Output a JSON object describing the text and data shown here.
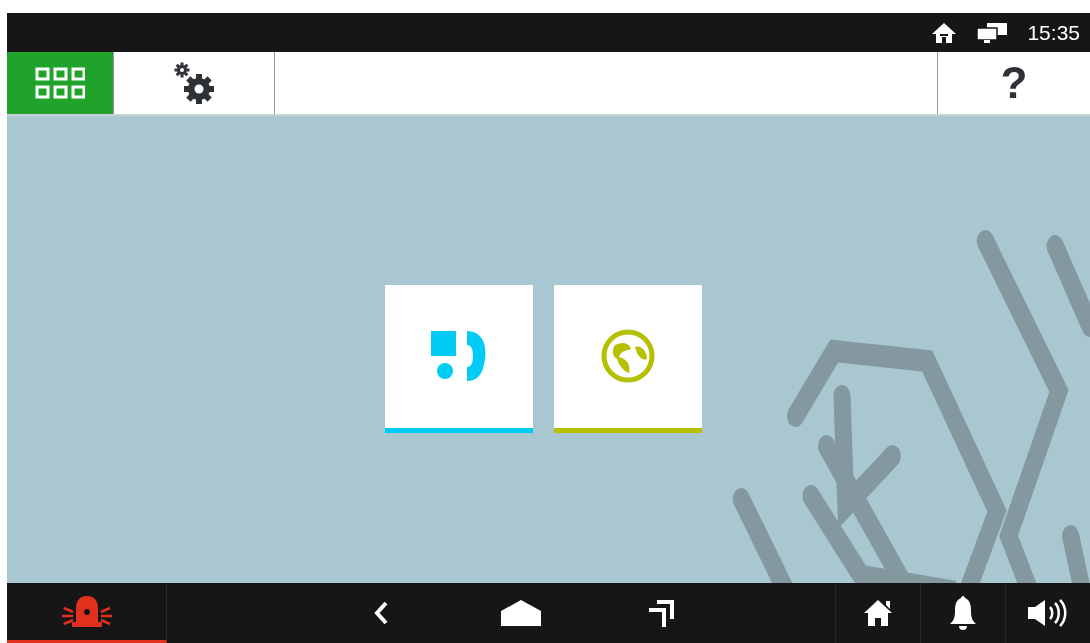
{
  "status_bar": {
    "time": "15:35"
  },
  "top_tabs": [
    {
      "kind": "apps",
      "selected": true
    },
    {
      "kind": "settings",
      "selected": false
    }
  ],
  "help_button": {
    "label": "?"
  },
  "tiles": [
    {
      "kind": "intercom",
      "color": "#00ccf5"
    },
    {
      "kind": "web",
      "color": "#b5c000"
    }
  ]
}
